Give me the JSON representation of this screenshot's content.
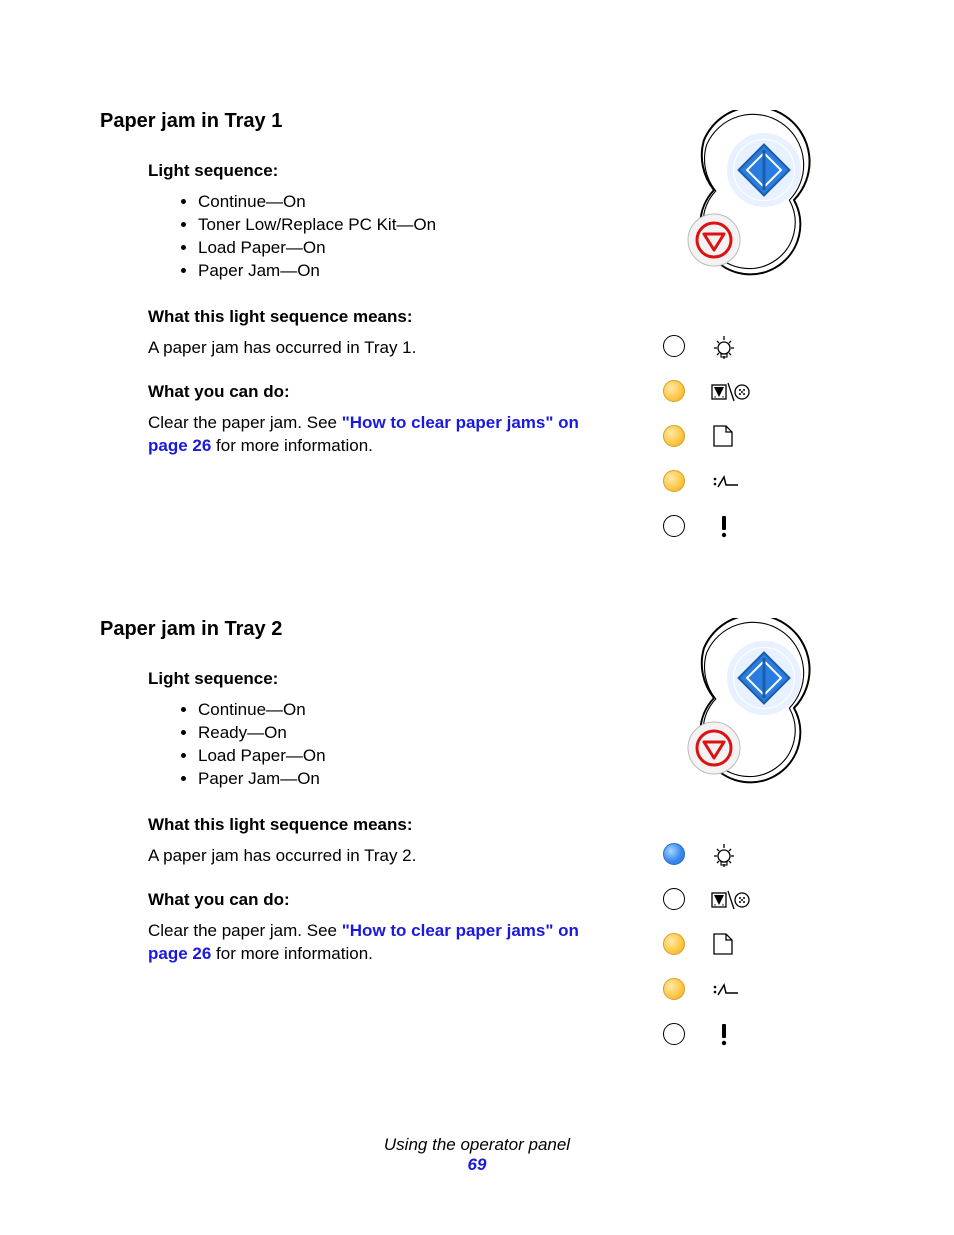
{
  "sections": [
    {
      "title": "Paper jam in Tray 1",
      "light_sequence_label": "Light sequence:",
      "lights": [
        "Continue—On",
        "Toner Low/Replace PC Kit—On",
        "Load Paper—On",
        "Paper Jam—On"
      ],
      "means_label": "What this light sequence means:",
      "means_text": "A paper jam has occurred in Tray 1.",
      "do_label": "What you can do:",
      "do_text_pre": "Clear the paper jam. See ",
      "do_link": "\"How to clear paper jams\" on page 26",
      "do_text_post": " for more information.",
      "leds": [
        "off",
        "amber",
        "amber",
        "amber",
        "off"
      ]
    },
    {
      "title": "Paper jam in Tray 2",
      "light_sequence_label": "Light sequence:",
      "lights": [
        "Continue—On",
        "Ready—On",
        "Load Paper—On",
        "Paper Jam—On"
      ],
      "means_label": "What this light sequence means:",
      "means_text": "A paper jam has occurred in Tray 2.",
      "do_label": "What you can do:",
      "do_text_pre": "Clear the paper jam. See ",
      "do_link": "\"How to clear paper jams\" on page 26",
      "do_text_post": " for more information.",
      "leds": [
        "blue",
        "off",
        "amber",
        "amber",
        "off"
      ]
    }
  ],
  "footer": {
    "title": "Using the operator panel",
    "page": "69"
  }
}
